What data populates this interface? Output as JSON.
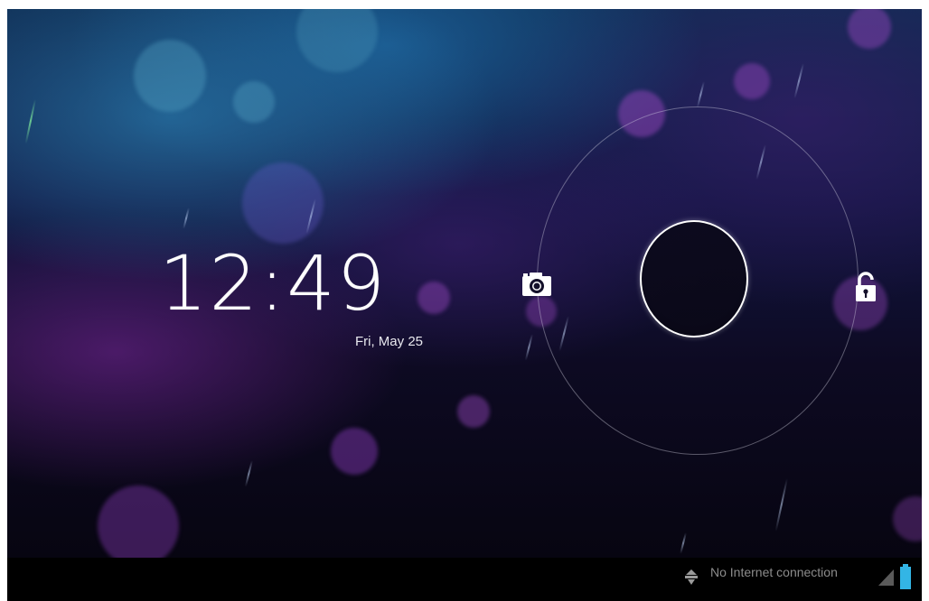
{
  "lockscreen": {
    "time_hours": "12",
    "time_colon": ":",
    "time_minutes": "49",
    "date": "Fri, May 25",
    "camera_target_icon": "camera-icon",
    "unlock_target_icon": "unlock-icon",
    "handle_icon": "unlock-handle-ring"
  },
  "statusbar": {
    "notification_icon": "android-notification-icon",
    "network_text": "No Internet connection",
    "signal_icon": "signal-icon",
    "battery_icon": "battery-icon"
  },
  "colors": {
    "clock_text": "#ffffff",
    "date_text": "#e8e8ee",
    "status_text": "#8b8b8b",
    "battery": "#33b5e5",
    "statusbar_bg": "#000000"
  }
}
